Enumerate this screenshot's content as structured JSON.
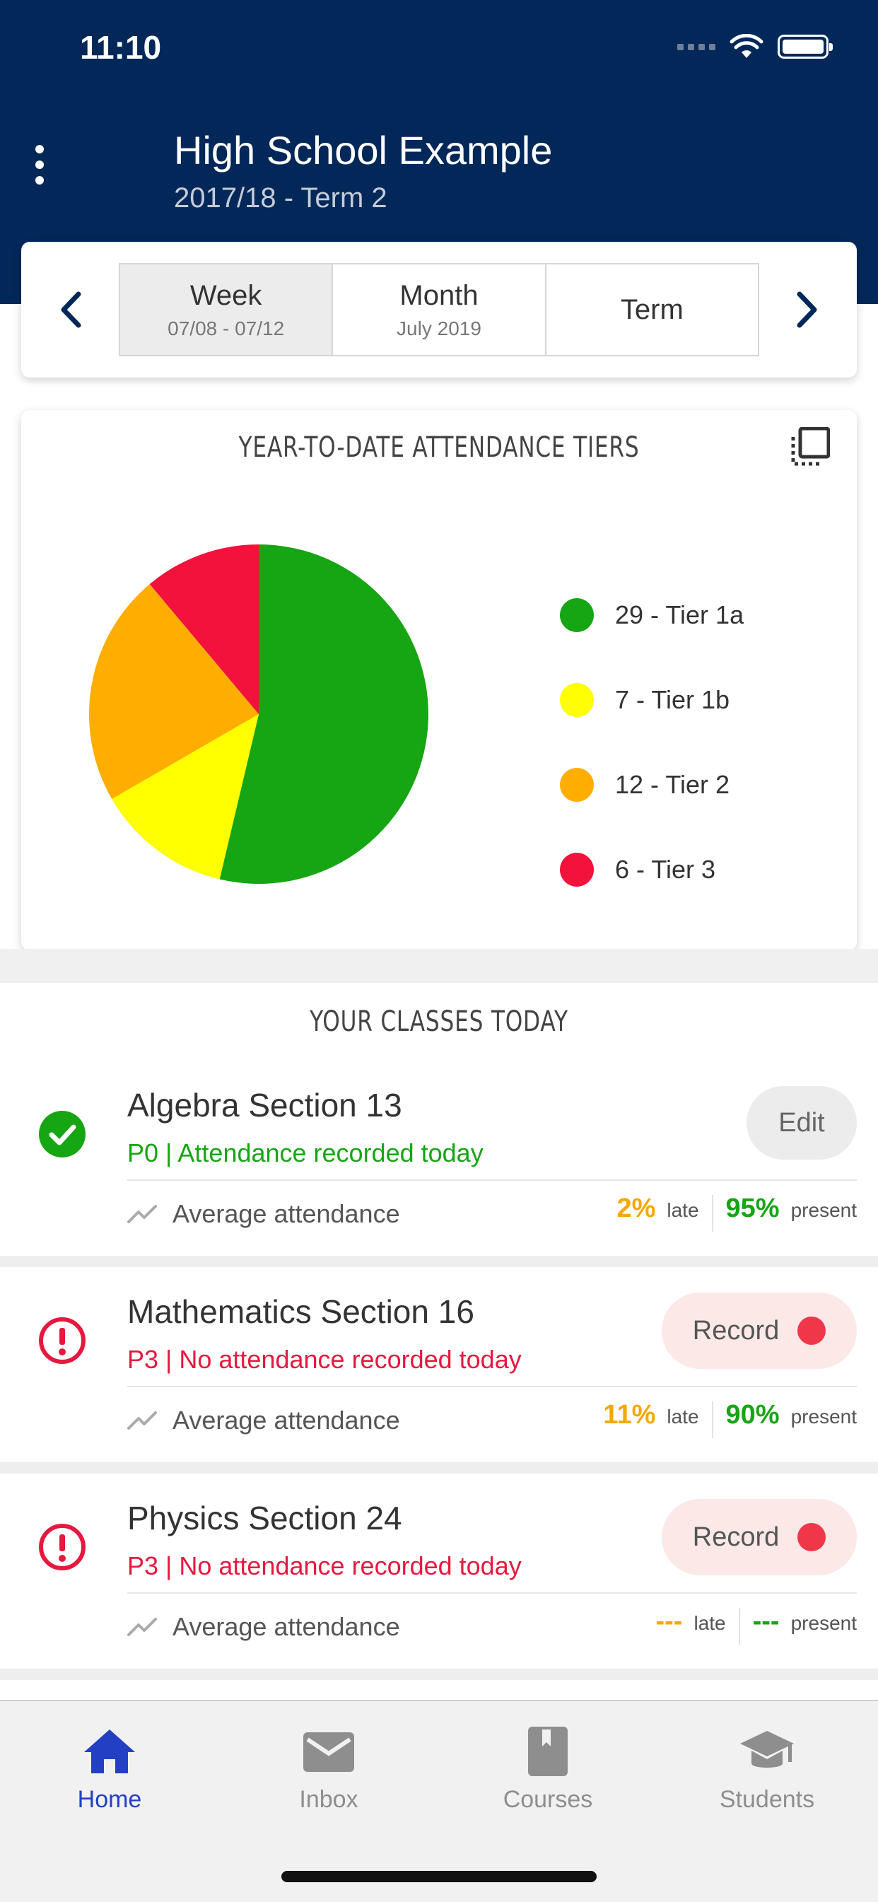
{
  "status_bar": {
    "time": "11:10"
  },
  "header": {
    "title": "High School Example",
    "term": "2017/18 - Term 2"
  },
  "period_selector": {
    "tabs": [
      {
        "label": "Week",
        "sub": "07/08 - 07/12"
      },
      {
        "label": "Month",
        "sub": "July 2019"
      },
      {
        "label": "Term",
        "sub": ""
      }
    ]
  },
  "chart_data": {
    "type": "pie",
    "title": "YEAR-TO-DATE ATTENDANCE TIERS",
    "legend_position": "right",
    "slices": [
      {
        "label": "29 - Tier 1a",
        "value": 29,
        "color": "#16a513"
      },
      {
        "label": "7 - Tier 1b",
        "value": 7,
        "color": "#ffff00"
      },
      {
        "label": "12 - Tier 2",
        "value": 12,
        "color": "#ffae00"
      },
      {
        "label": "6 - Tier 3",
        "value": 6,
        "color": "#f2123b"
      }
    ]
  },
  "classes": {
    "title": "YOUR CLASSES TODAY",
    "items": [
      {
        "name": "Algebra Section 13",
        "status": "P0 | Attendance recorded today",
        "avg_label": "Average attendance",
        "late": "2%",
        "late_unit": "late",
        "present": "95%",
        "present_unit": "present",
        "action": "Edit"
      },
      {
        "name": "Mathematics Section 16",
        "status": "P3 | No attendance recorded today",
        "avg_label": "Average attendance",
        "late": "11%",
        "late_unit": "late",
        "present": "90%",
        "present_unit": "present",
        "action": "Record"
      },
      {
        "name": "Physics Section 24",
        "status": "P3 | No attendance recorded today",
        "avg_label": "Average attendance",
        "late": "---",
        "late_unit": "late",
        "present": "---",
        "present_unit": "present",
        "action": "Record"
      }
    ]
  },
  "tabbar": {
    "items": [
      {
        "label": "Home",
        "icon": "home-icon"
      },
      {
        "label": "Inbox",
        "icon": "mail-icon"
      },
      {
        "label": "Courses",
        "icon": "book-icon"
      },
      {
        "label": "Students",
        "icon": "graduation-cap-icon"
      }
    ]
  },
  "colors": {
    "header_bg": "#022859",
    "recorded_green": "#16a513",
    "missing_red": "#e5193f",
    "late_orange": "#f5a800",
    "active_tab": "#2340c4",
    "inactive_tab": "#8e8e8e"
  }
}
